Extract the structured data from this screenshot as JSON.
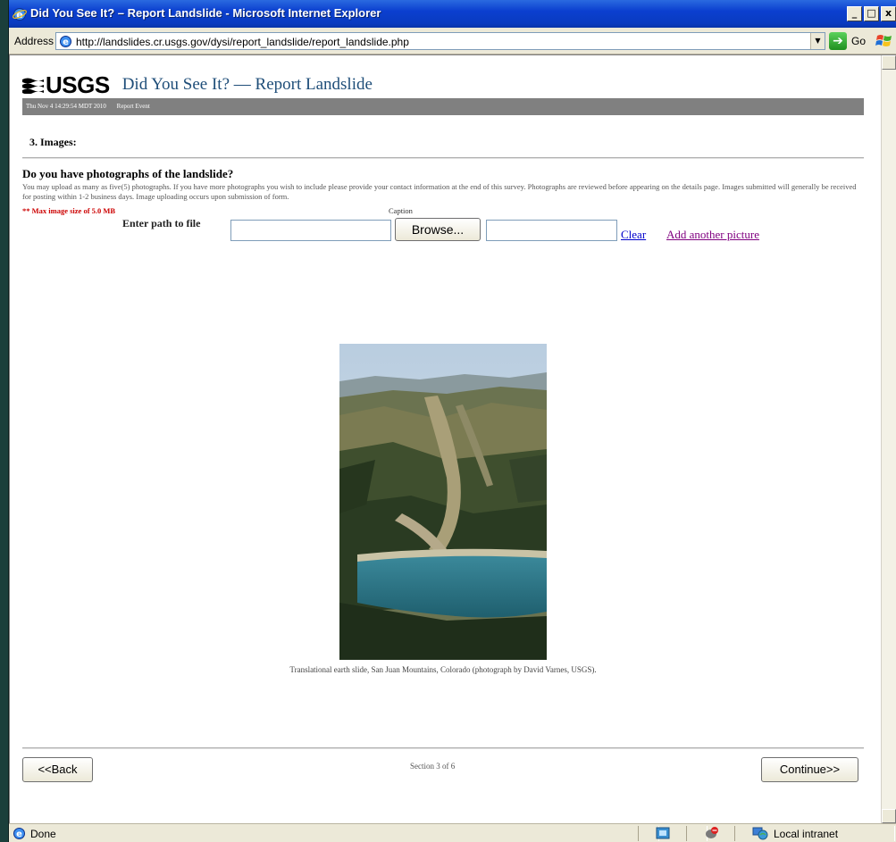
{
  "window": {
    "title": "Did You See It? – Report Landslide - Microsoft Internet Explorer",
    "minimize": "_",
    "restore": "□",
    "close": "x"
  },
  "addressbar": {
    "label": "Address",
    "url": "http://landslides.cr.usgs.gov/dysi/report_landslide/report_landslide.php",
    "go_label": "Go"
  },
  "header": {
    "logo_text": "USGS",
    "title": "Did You See It? — Report Landslide",
    "timestamp": "Thu Nov 4 14:29:54 MDT 2010",
    "breadcrumb": "Report Event"
  },
  "section": {
    "label": "3. Images:"
  },
  "form": {
    "question": "Do you have photographs of the landslide?",
    "instructions": "You may upload as many as five(5) photographs. If you have more photographs you wish to include please provide your contact information at the end of this survey. Photographs are reviewed before appearing on the details page. Images submitted will generally be received for posting within 1-2 business days. Image uploading occurs upon submission of form.",
    "max_size_note": "** Max image size of 5.0 MB",
    "caption_header": "Caption",
    "path_label": "Enter path to file",
    "file_value": "",
    "browse_label": "Browse...",
    "caption_value": "",
    "clear_link": "Clear",
    "add_link": "Add another picture"
  },
  "photo": {
    "caption": "Translational earth slide, San Juan Mountains, Colorado (photograph by David Varnes, USGS)."
  },
  "footer": {
    "back_label": "<<Back",
    "progress": "Section 3 of 6",
    "continue_label": "Continue>>"
  },
  "statusbar": {
    "status": "Done",
    "zone": "Local intranet"
  }
}
